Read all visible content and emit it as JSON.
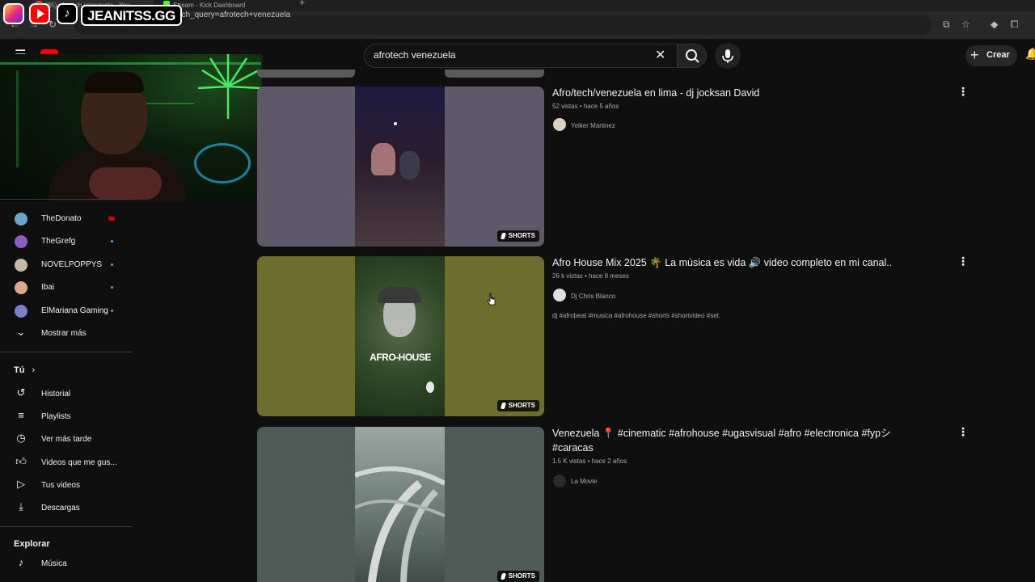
{
  "browser": {
    "tabs": [
      {
        "label": "(85) afrotech venezuela - You"
      },
      {
        "label": "Stream - Kick Dashboard"
      }
    ],
    "new_tab": "+",
    "url": "youtube.com/results?search_query=afrotech+venezuela"
  },
  "social_banner": {
    "handle": "JEANITSS.GG",
    "icons": [
      "instagram-icon",
      "youtube-icon",
      "tiktok-icon"
    ]
  },
  "header": {
    "search_value": "afrotech venezuela",
    "create_label": "Crear"
  },
  "sidebar": {
    "subscriptions": [
      {
        "name": "TheDonato",
        "status": "live",
        "avatar_color": "#6aa6c9"
      },
      {
        "name": "TheGrefg",
        "status": "new",
        "avatar_color": "#8a5cc4"
      },
      {
        "name": "NOVELPOPPYS",
        "status": "new",
        "avatar_color": "#c7b9a7"
      },
      {
        "name": "Ibai",
        "status": "new",
        "avatar_color": "#d8a98b"
      },
      {
        "name": "ElMariana Gaming",
        "status": "new",
        "avatar_color": "#7b7fc9"
      }
    ],
    "show_more": "Mostrar más",
    "you_title": "Tú",
    "you_items": [
      {
        "label": "Historial",
        "icon": "history-icon"
      },
      {
        "label": "Playlists",
        "icon": "playlists-icon"
      },
      {
        "label": "Ver más tarde",
        "icon": "watch-later-icon"
      },
      {
        "label": "Videos que me gus...",
        "icon": "thumbs-up-icon"
      },
      {
        "label": "Tus videos",
        "icon": "your-videos-icon"
      },
      {
        "label": "Descargas",
        "icon": "download-icon"
      }
    ],
    "explore_title": "Explorar",
    "explore_items": [
      {
        "label": "Música",
        "icon": "music-icon"
      }
    ]
  },
  "results": [
    {
      "title": "Afro/tech/venezuela en lima - dj jocksan David",
      "meta": "52 vistas • hace 5 años",
      "channel": "Yeiker Martinez",
      "badge": "SHORTS",
      "thumb_bg": "#5f5869",
      "thumb_inner": "#1d1a2e"
    },
    {
      "title": "Afro House Mix 2025 🌴 La música es vida 🔊 video completo en mi canal..",
      "meta": "26 k vistas • hace 8 meses",
      "channel": "Dj Chris Blanco",
      "description": "dj #afrobeat #musica #afrohouse #shorts #shortvideo #set.",
      "badge": "SHORTS",
      "thumb_bg": "#6d6e2e",
      "thumb_inner": "#2f4a26",
      "thumb_text": "AFRO-HOUSE"
    },
    {
      "title": "Venezuela 📍 #cinematic #afrohouse #ugasvisual #afro #electronica #fypシ #caracas",
      "meta": "1.5 K vistas • hace 2 años",
      "channel": "La Movie",
      "badge": "SHORTS",
      "thumb_bg": "#4e5b57",
      "thumb_inner": "#7f8c87"
    }
  ]
}
